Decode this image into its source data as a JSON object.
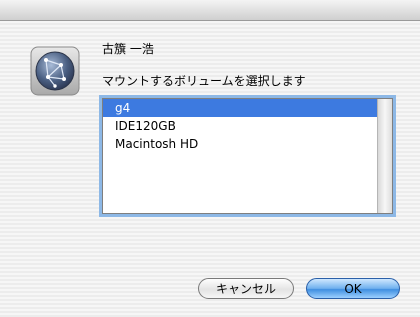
{
  "dialog": {
    "user_name": "古籏 一浩",
    "prompt": "マウントするボリュームを選択します"
  },
  "volumes": {
    "items": [
      "g4",
      "IDE120GB",
      "Macintosh HD"
    ],
    "selected_index": 0
  },
  "buttons": {
    "cancel_label": "キャンセル",
    "ok_label": "OK"
  },
  "icons": {
    "app": "network-globe-icon"
  },
  "colors": {
    "selection": "#3d7ae0",
    "focus_ring": "#8db8e6",
    "default_button": "#4a97e6"
  }
}
